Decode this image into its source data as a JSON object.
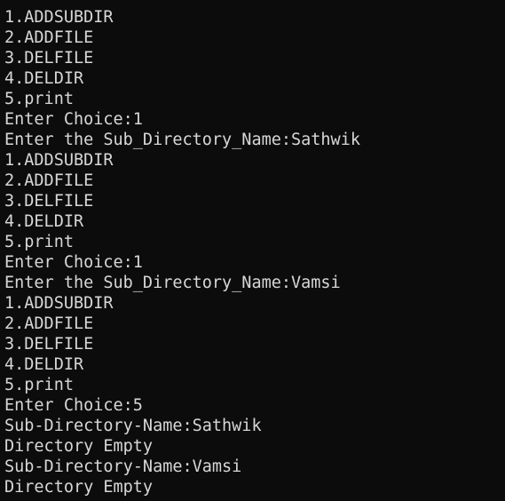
{
  "terminal": {
    "lines": [
      "1.ADDSUBDIR",
      "2.ADDFILE",
      "3.DELFILE",
      "4.DELDIR",
      "5.print",
      "Enter Choice:1",
      "Enter the Sub_Directory_Name:Sathwik",
      "1.ADDSUBDIR",
      "2.ADDFILE",
      "3.DELFILE",
      "4.DELDIR",
      "5.print",
      "Enter Choice:1",
      "Enter the Sub_Directory_Name:Vamsi",
      "1.ADDSUBDIR",
      "2.ADDFILE",
      "3.DELFILE",
      "4.DELDIR",
      "5.print",
      "Enter Choice:5",
      "Sub-Directory-Name:Sathwik",
      "Directory Empty",
      "Sub-Directory-Name:Vamsi",
      "Directory Empty"
    ]
  },
  "colors": {
    "background": "#0c0c0c",
    "text": "#d7d7d7"
  }
}
